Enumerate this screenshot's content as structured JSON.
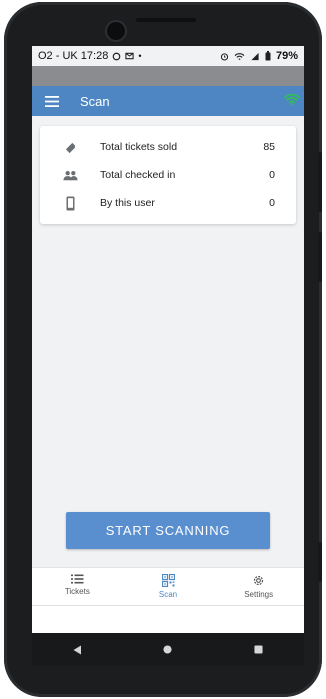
{
  "status_bar": {
    "carrier_time": "O2 - UK 17:28",
    "battery": "79%"
  },
  "app_bar": {
    "title": "Scan",
    "menu_icon": "hamburger-menu-icon",
    "connection_icon": "wifi-icon",
    "connection_color": "#2fc24a"
  },
  "stats": [
    {
      "icon": "ticket-icon",
      "label": "Total tickets sold",
      "value": "85"
    },
    {
      "icon": "people-icon",
      "label": "Total checked in",
      "value": "0"
    },
    {
      "icon": "phone-icon",
      "label": "By this user",
      "value": "0"
    }
  ],
  "start_button": {
    "label": "START SCANNING"
  },
  "bottom_nav": {
    "items": [
      {
        "icon": "list-icon",
        "label": "Tickets",
        "active": false
      },
      {
        "icon": "qr-code-icon",
        "label": "Scan",
        "active": true
      },
      {
        "icon": "gear-icon",
        "label": "Settings",
        "active": false
      }
    ]
  },
  "colors": {
    "primary": "#4e86c4",
    "button": "#5a8fcf",
    "background": "#f1f2f4"
  }
}
